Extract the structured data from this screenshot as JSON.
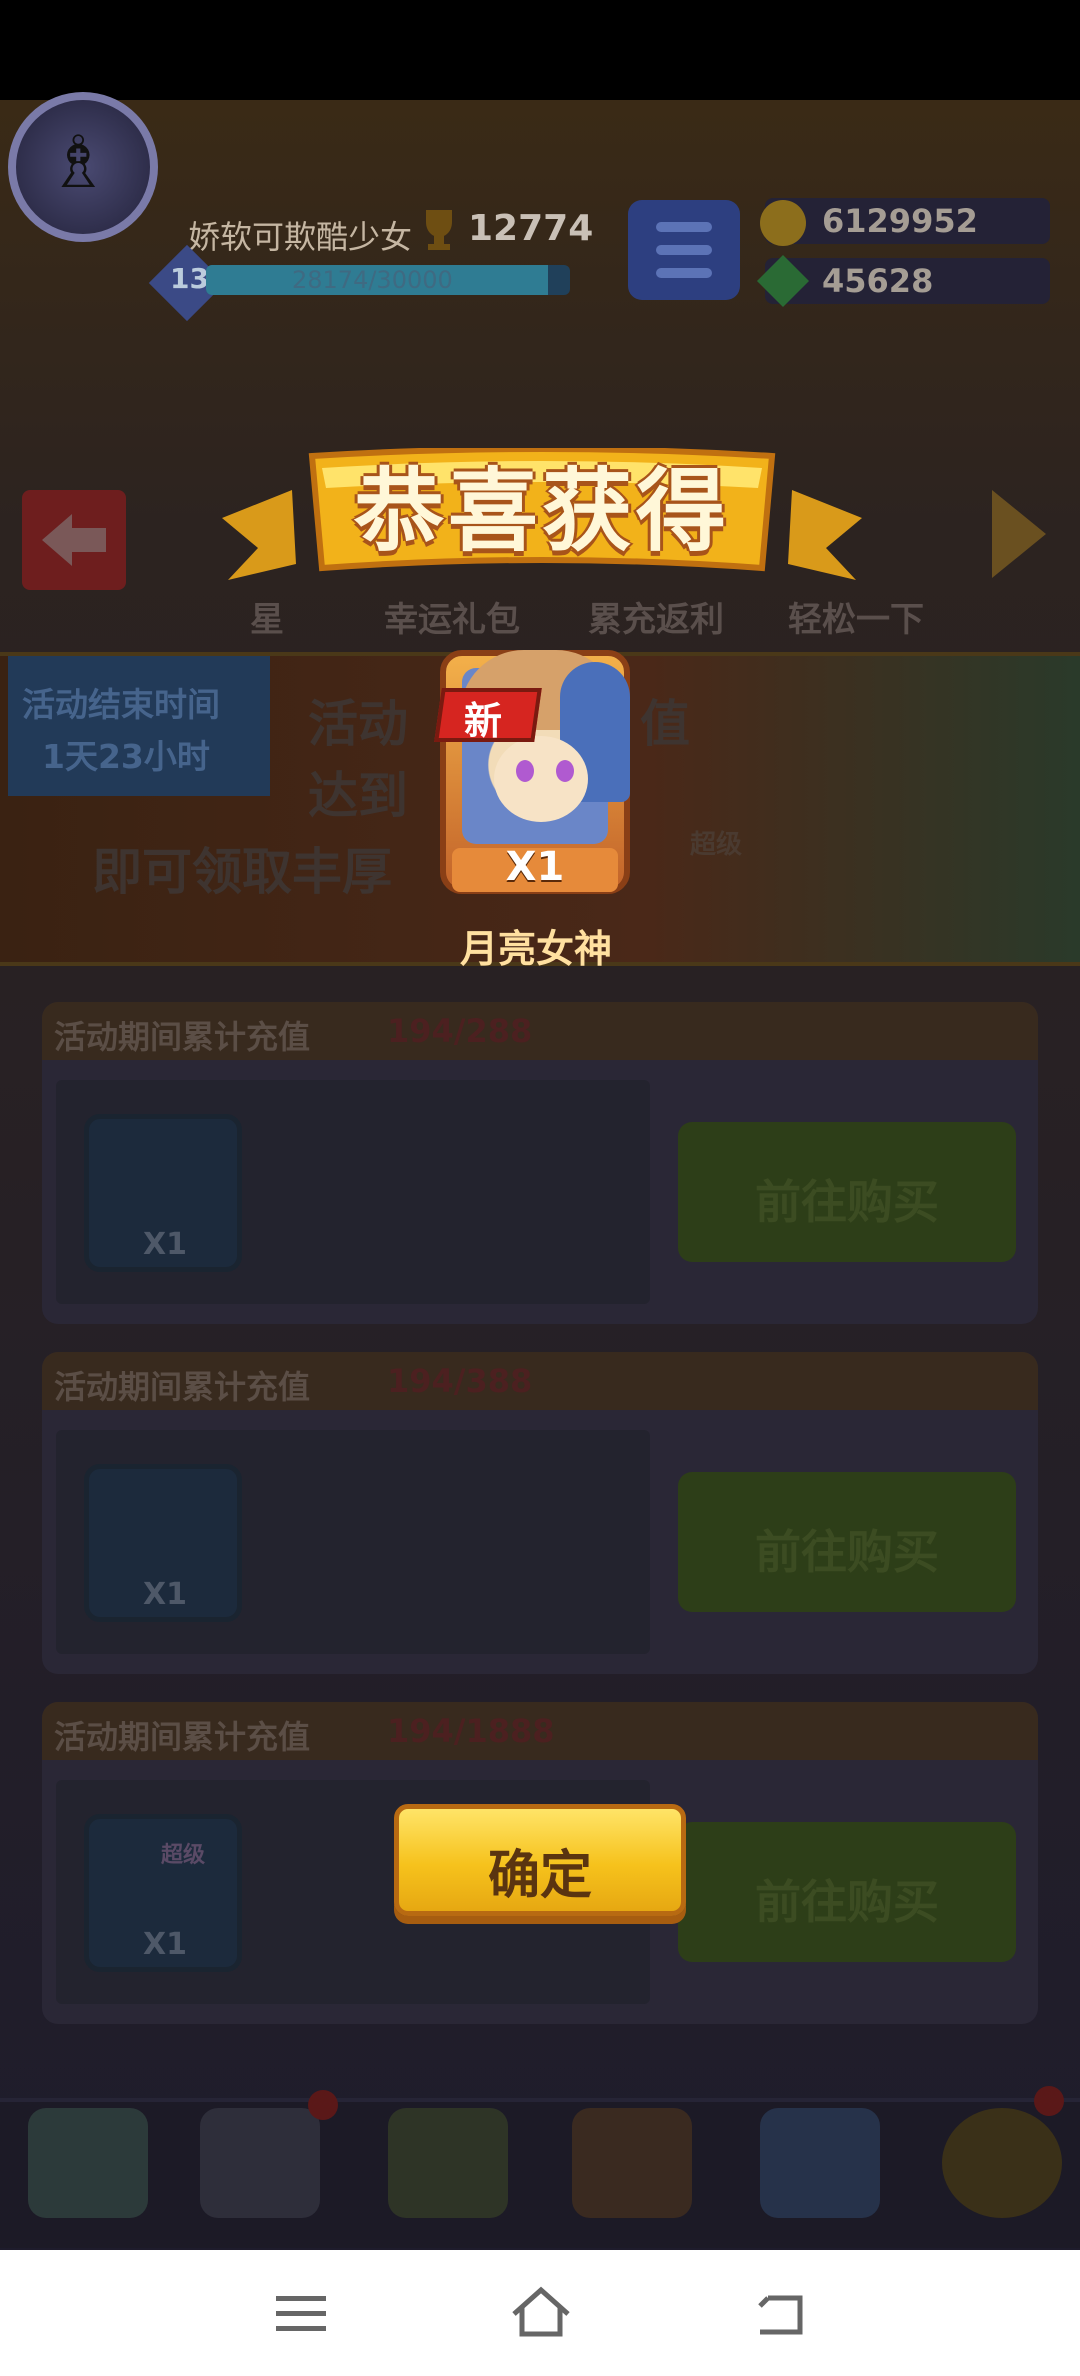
{
  "player": {
    "name": "娇软可欺酷少女",
    "trophies": "12774",
    "level": "13",
    "exp": "28174/30000",
    "exp_fraction": 0.94
  },
  "currency": {
    "coins": "6129952",
    "gems": "45628"
  },
  "tabs": [
    "星",
    "幸运礼包",
    "累充返利",
    "轻松一下"
  ],
  "banner": {
    "timer_label": "活动结束时间",
    "timer_value": "1天23小时",
    "line1": "活动",
    "line1_tail": "值",
    "line2": "达到",
    "line3": "即可领取丰厚",
    "super_badge": "超级"
  },
  "cards": [
    {
      "title": "活动期间累计充值",
      "progress": "194/288",
      "qty": "X1",
      "button": "前往购买"
    },
    {
      "title": "活动期间累计充值",
      "progress": "194/388",
      "qty": "X1",
      "button": "前往购买"
    },
    {
      "title": "活动期间累计充值",
      "progress": "194/1888",
      "qty": "X1",
      "button": "前往购买",
      "badge": "超级"
    }
  ],
  "popup": {
    "title": "恭喜获得",
    "new_badge": "新",
    "item_qty": "X1",
    "item_name": "月亮女神",
    "confirm": "确定"
  },
  "colors": {
    "popup_gold": "#f6c21c",
    "ribbon_brown": "#a8541a",
    "new_red": "#d62520"
  }
}
